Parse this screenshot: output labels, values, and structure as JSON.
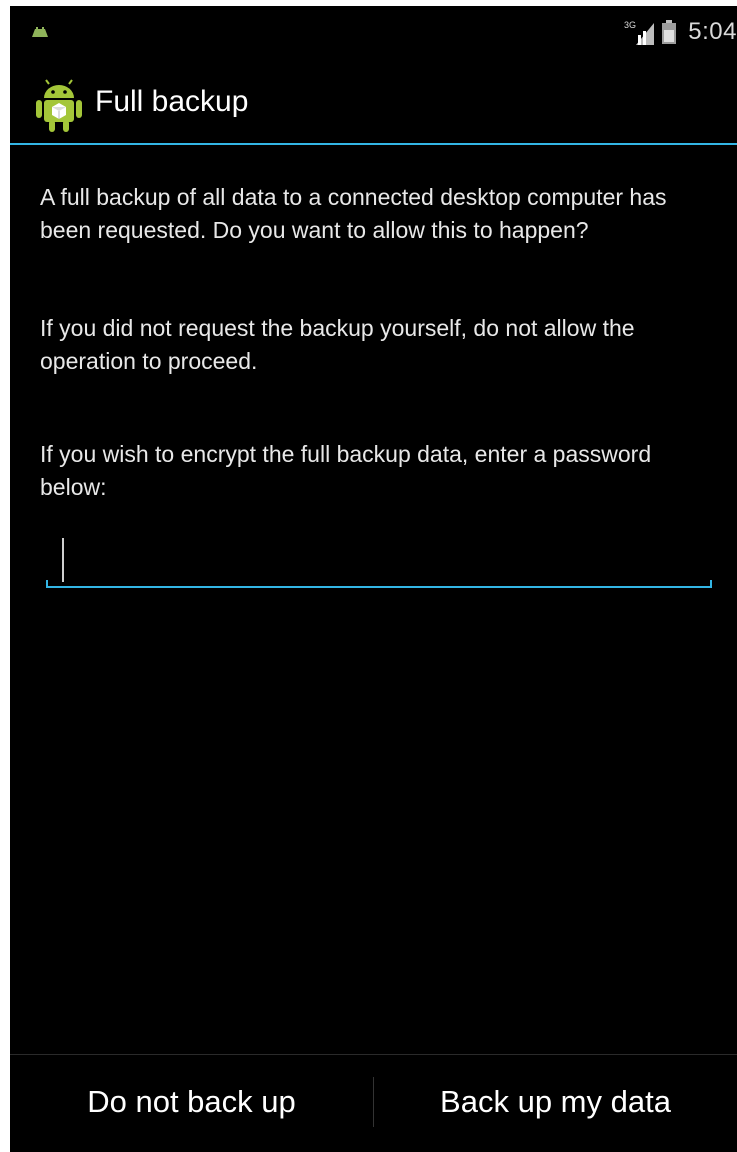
{
  "status_bar": {
    "time": "5:04",
    "network_label": "3G",
    "icons": [
      "android-notification-icon",
      "signal-3g-icon",
      "battery-icon"
    ]
  },
  "action_bar": {
    "title": "Full backup",
    "icon": "android-app-icon"
  },
  "dialog": {
    "paragraph_1": "A full backup of all data to a connected desktop computer has been requested. Do you want to allow this to happen?",
    "paragraph_2": "If you did not request the backup yourself, do not allow the operation to proceed.",
    "paragraph_3": "If you wish to encrypt the full backup data, enter a password below:",
    "password_value": "",
    "password_placeholder": ""
  },
  "buttons": {
    "deny_label": "Do not back up",
    "allow_label": "Back up my data"
  },
  "colors": {
    "accent": "#33b5e5",
    "background": "#000000",
    "text": "#ffffff",
    "android_green": "#a4c639"
  }
}
